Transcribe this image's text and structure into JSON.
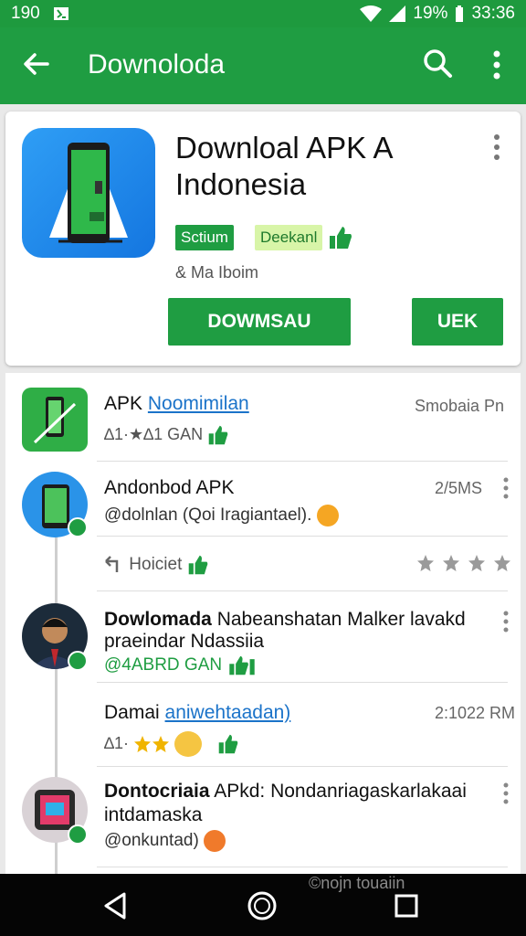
{
  "status_bar": {
    "left_text": "190",
    "battery": "19%",
    "time": "33:36"
  },
  "app_bar": {
    "title": "Downoloda"
  },
  "app_card": {
    "title": "Downloal APK A Indonesia",
    "tag_primary": "Sctium",
    "tag_secondary": "Deekanl",
    "subtitle": "& Ma Iboim",
    "button_primary": "DOWMSAU",
    "button_secondary": "UEK"
  },
  "list": [
    {
      "title_prefix": "APK",
      "title_link": "Noomimilan",
      "meta": "Smobaia Pn",
      "sub": "∆1·★∆1 GAN"
    },
    {
      "title": "Andonbod APK",
      "meta": "2/5MS",
      "sub": "@dolnlan (Qoi Iragiantael)."
    },
    {
      "sub_left": "Hoiciet"
    },
    {
      "title_bold": "Dowlomada",
      "title_rest": "Nabeanshatan Malker lavakd",
      "line2": "praeindar Ndassiia",
      "sub": "@4ABRD GAN"
    },
    {
      "title_prefix": "Damai",
      "title_link": "aniwehtaadan)",
      "meta": "2:1022 RM",
      "sub": "∆1·"
    },
    {
      "title_bold": "Dontocriaia",
      "title_rest": "APkd: Nondanriagaskarlakaai",
      "line2": "intdamaska",
      "sub": "@onkuntad)"
    }
  ],
  "watermark": "©nojn touaiin",
  "icons": {
    "back": "arrow-left-icon",
    "search": "search-icon",
    "more": "more-vert-icon",
    "thumb": "thumbs-up-icon",
    "star": "star-icon",
    "nav_back": "triangle-back-icon",
    "nav_home": "circle-home-icon",
    "nav_recent": "square-recent-icon"
  },
  "colors": {
    "primary": "#1f9d42",
    "link": "#1b73c9",
    "star": "#f0b400",
    "lime": "#d8f5a8"
  }
}
